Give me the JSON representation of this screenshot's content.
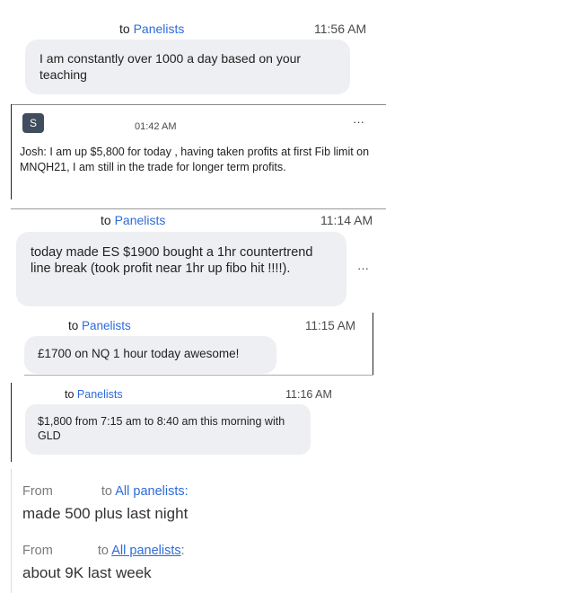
{
  "msg1": {
    "to_prefix": "to",
    "to_target": "Panelists",
    "time": "11:56 AM",
    "text": "I am constantly over 1000 a day based on your teaching"
  },
  "msg2": {
    "avatar_letter": "S",
    "time": "01:42 AM",
    "menu": "···",
    "text": "Josh: I am up $5,800 for today , having taken profits at first Fib limit on MNQH21, I am still in the trade for longer term profits."
  },
  "msg3": {
    "to_prefix": "to",
    "to_target": "Panelists",
    "time": "11:14 AM",
    "text": "today made ES $1900 bought a 1hr countertrend line break (took profit near 1hr up fibo hit !!!!).",
    "menu": "···"
  },
  "msg4": {
    "to_prefix": "to",
    "to_target": "Panelists",
    "time": "11:15 AM",
    "text": "£1700 on NQ 1 hour today awesome!"
  },
  "msg5": {
    "to_prefix": "to",
    "to_target": "Panelists",
    "time": "11:16 AM",
    "text": "$1,800 from 7:15 am to 8:40 am this morning with GLD"
  },
  "msg6": {
    "from": "From",
    "to_prefix": "to",
    "to_target": "All panelists:",
    "text": "made 500 plus last night"
  },
  "msg7": {
    "from": "From",
    "to_prefix": "to",
    "to_target": "All panelists",
    "colon": ":",
    "text": "about 9K last week"
  }
}
